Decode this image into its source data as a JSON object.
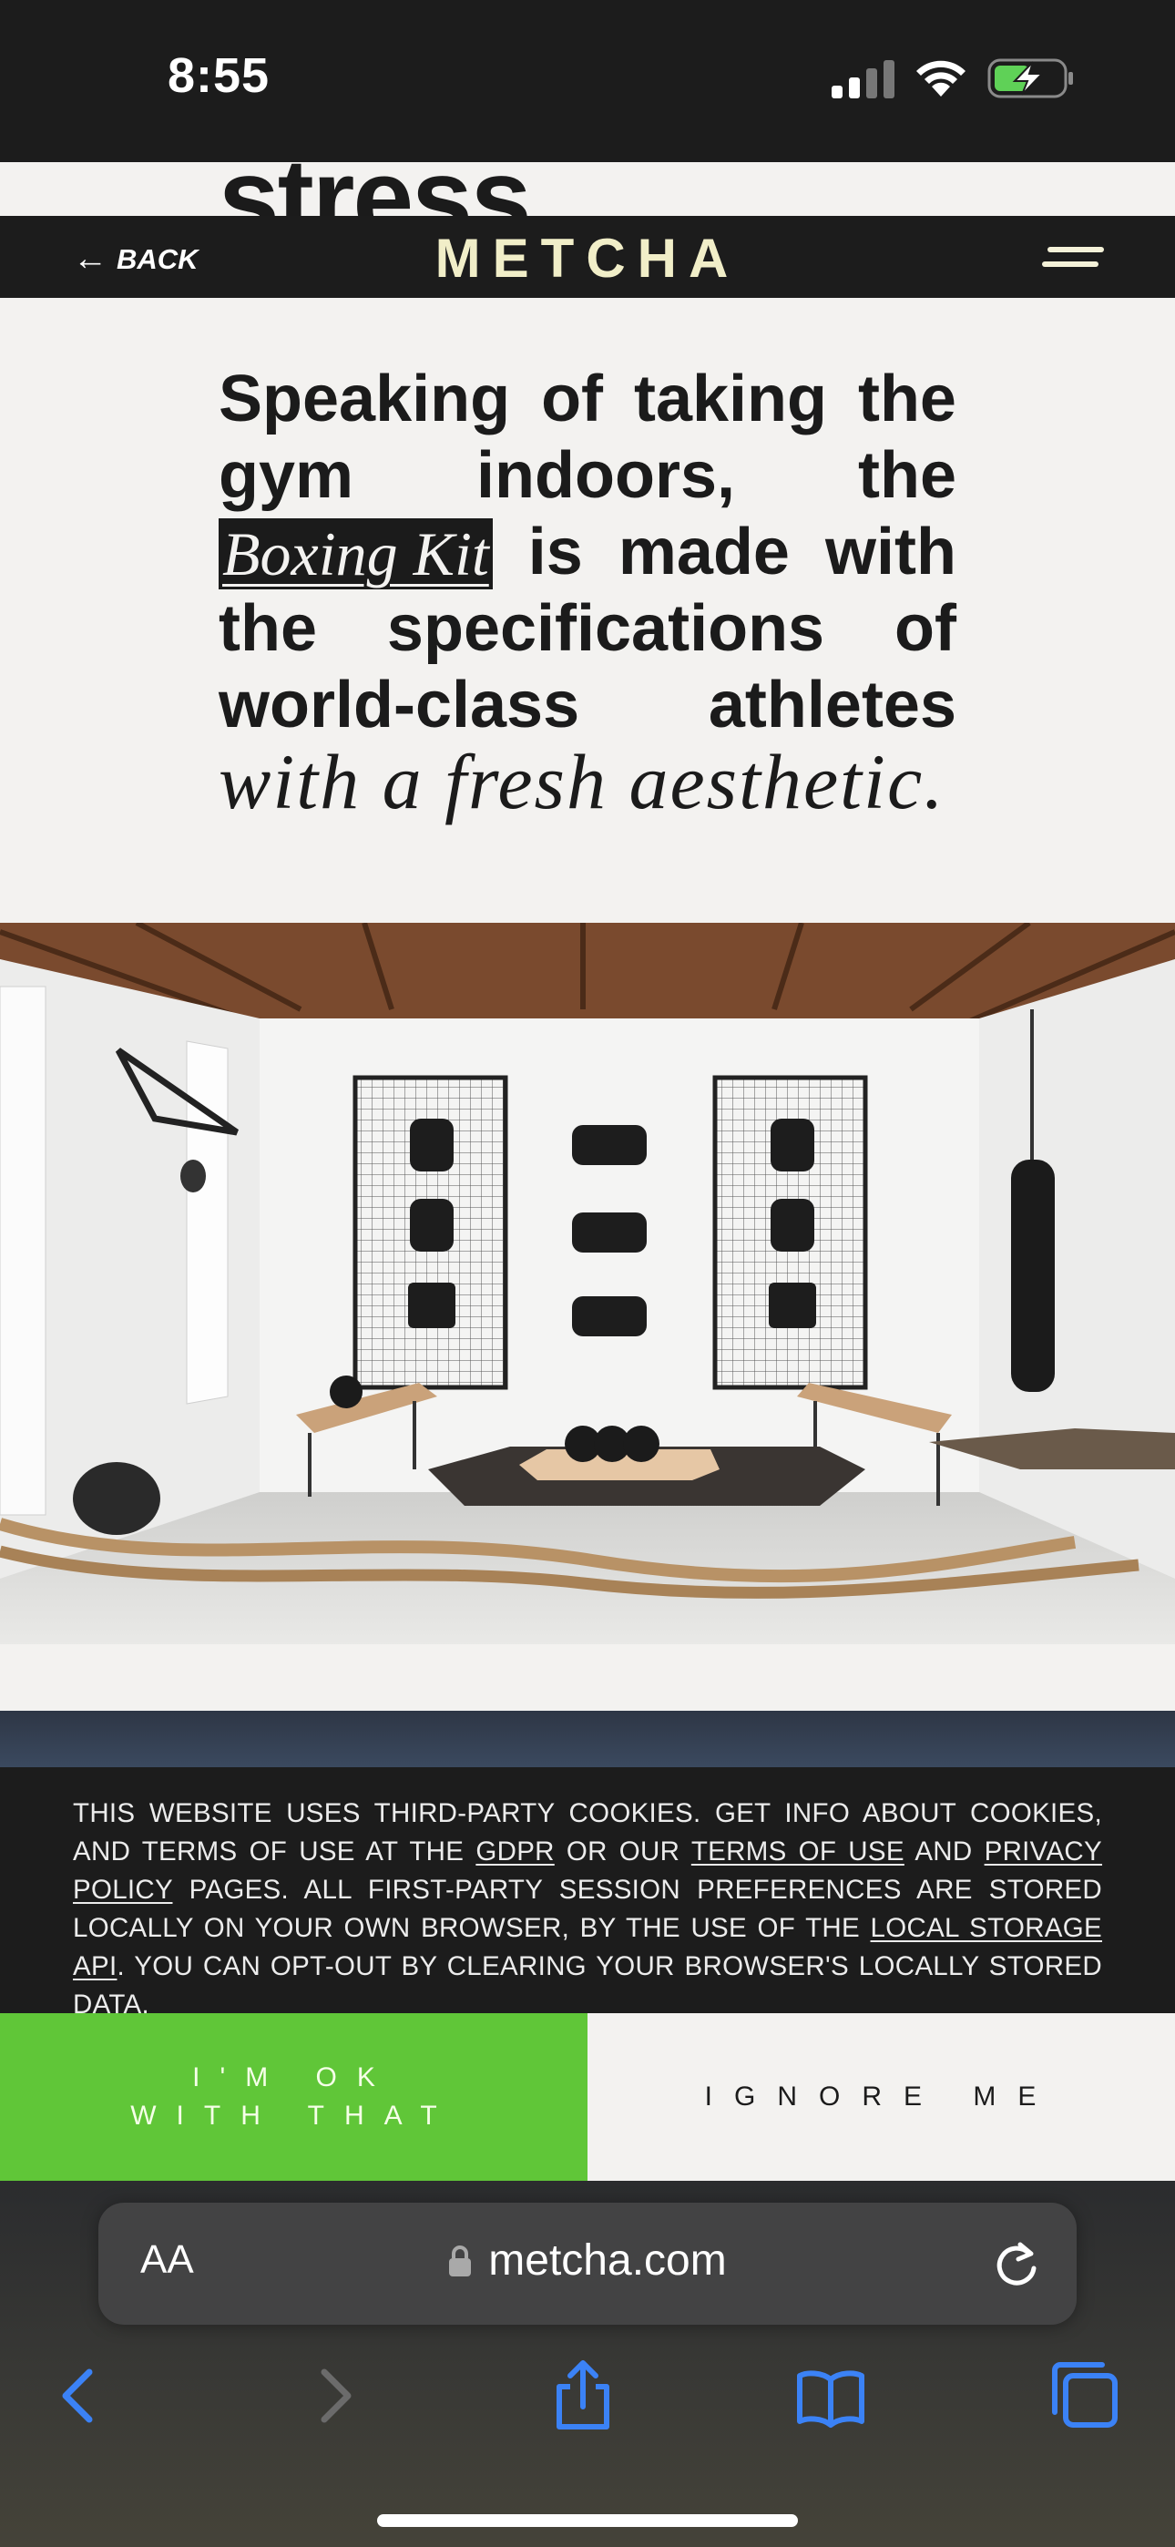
{
  "status_bar": {
    "time": "8:55"
  },
  "page": {
    "scrolled_heading": "stress",
    "header": {
      "back_label": "BACK",
      "brand": "METCHA"
    },
    "intro": {
      "line1": [
        "Speaking",
        "of",
        "taking",
        "the"
      ],
      "line2": [
        "gym",
        "indoors,",
        "the"
      ],
      "kit_link": "Boxing Kit",
      "line3_rest": [
        "is",
        "made",
        "with"
      ],
      "line4": [
        "the",
        "specifications",
        "of"
      ],
      "line5": [
        "world-class",
        "athletes"
      ],
      "tail": "with a fresh aesthetic."
    }
  },
  "cookie_banner": {
    "text_1": "THIS WEBSITE USES THIRD-PARTY COOKIES. GET INFO ABOUT COOKIES, AND TERMS OF USE AT THE ",
    "link_gdpr": "GDPR",
    "text_2": " OR OUR ",
    "link_terms": "TERMS OF USE",
    "text_3": " AND ",
    "link_privacy": "PRIVACY POLICY",
    "text_4": " PAGES. ALL FIRST-PARTY SESSION PREFERENCES ARE STORED LOCALLY ON YOUR OWN BROWSER, BY THE USE OF THE ",
    "link_storage": "LOCAL STORAGE API",
    "text_5": ". YOU CAN OPT-OUT BY CLEARING YOUR BROWSER'S LOCALLY STORED DATA.",
    "accept_label": "I'M OK WITH THAT",
    "ignore_label": "IGNORE ME"
  },
  "browser": {
    "aa_label": "AA",
    "url": "metcha.com"
  },
  "colors": {
    "accent_green": "#60c638",
    "brand_cream": "#f1eec8",
    "ios_blue": "#3b82f6"
  }
}
